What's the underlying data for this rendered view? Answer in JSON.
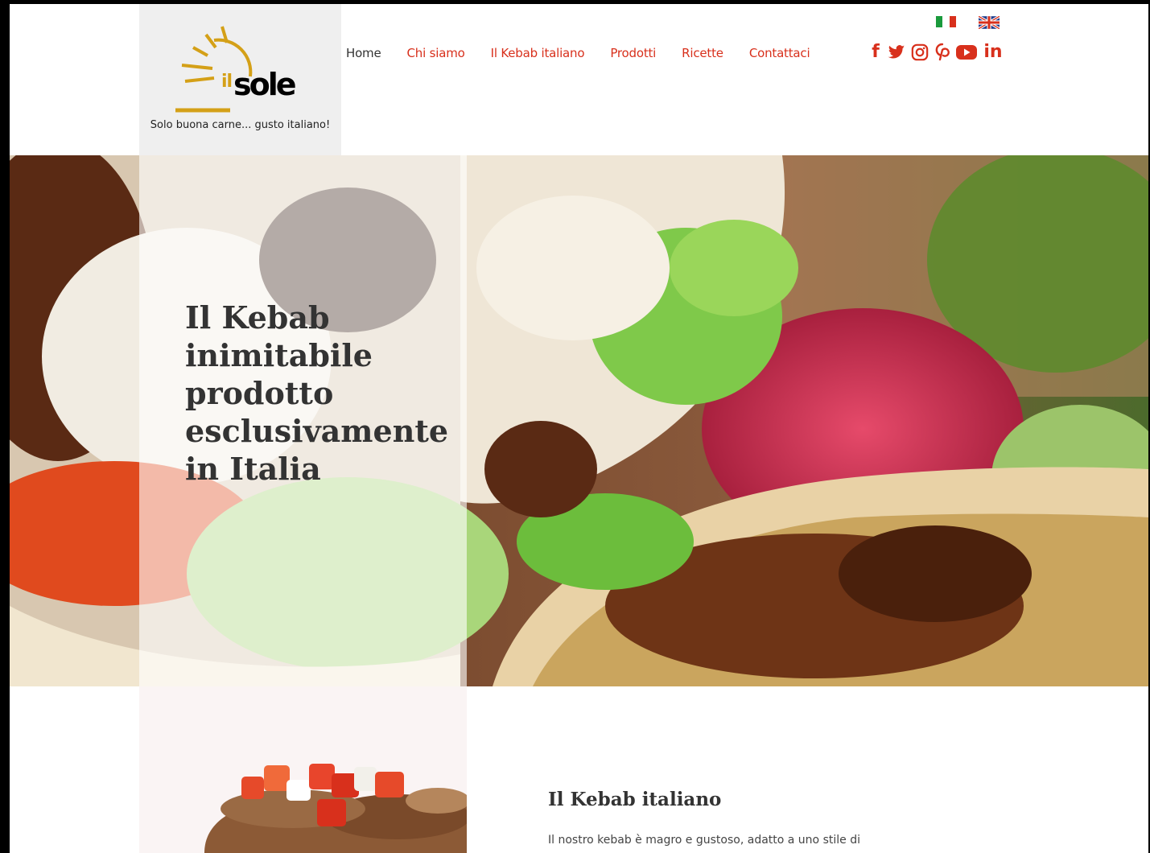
{
  "header": {
    "logo_prefix": "il",
    "logo_name": "sole",
    "tagline": "Solo buona carne... gusto italiano!"
  },
  "nav": {
    "items": [
      {
        "label": "Home",
        "active": true
      },
      {
        "label": "Chi siamo"
      },
      {
        "label": "Il Kebab italiano"
      },
      {
        "label": "Prodotti"
      },
      {
        "label": "Ricette"
      },
      {
        "label": "Contattaci"
      }
    ]
  },
  "languages": [
    "italian-flag-icon",
    "uk-flag-icon"
  ],
  "social": {
    "icons": [
      "facebook-icon",
      "twitter-icon",
      "instagram-icon",
      "pinterest-icon",
      "youtube-icon",
      "linkedin-icon"
    ],
    "facebook_glyph": "f",
    "linkedin_glyph": "in"
  },
  "hero": {
    "title": "Il Kebab inimitabile prodotto esclusivamente in Italia"
  },
  "intro": {
    "title": "Il Kebab italiano",
    "text": "Il nostro kebab è magro e gustoso, adatto a uno stile di"
  },
  "colors": {
    "accent": "#d8301c",
    "logo_gold": "#d4a017",
    "panel_gray": "#efefef"
  }
}
